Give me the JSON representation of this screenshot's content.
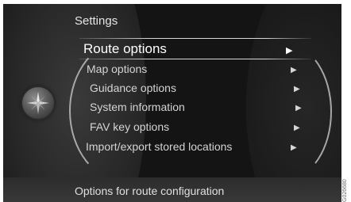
{
  "header": {
    "title": "Settings"
  },
  "menu": {
    "items": [
      {
        "label": "Route options",
        "selected": true
      },
      {
        "label": "Map options"
      },
      {
        "label": "Guidance options"
      },
      {
        "label": "System information"
      },
      {
        "label": "FAV key options"
      },
      {
        "label": "Import/export stored locations"
      }
    ],
    "arrow_glyph": "▶"
  },
  "footer": {
    "description": "Options for route configuration"
  },
  "icons": {
    "nav": "compass-icon"
  },
  "colors": {
    "background": "#141414",
    "text": "#d4d4d4",
    "highlight": "#ffffff"
  },
  "watermark": "G026680"
}
